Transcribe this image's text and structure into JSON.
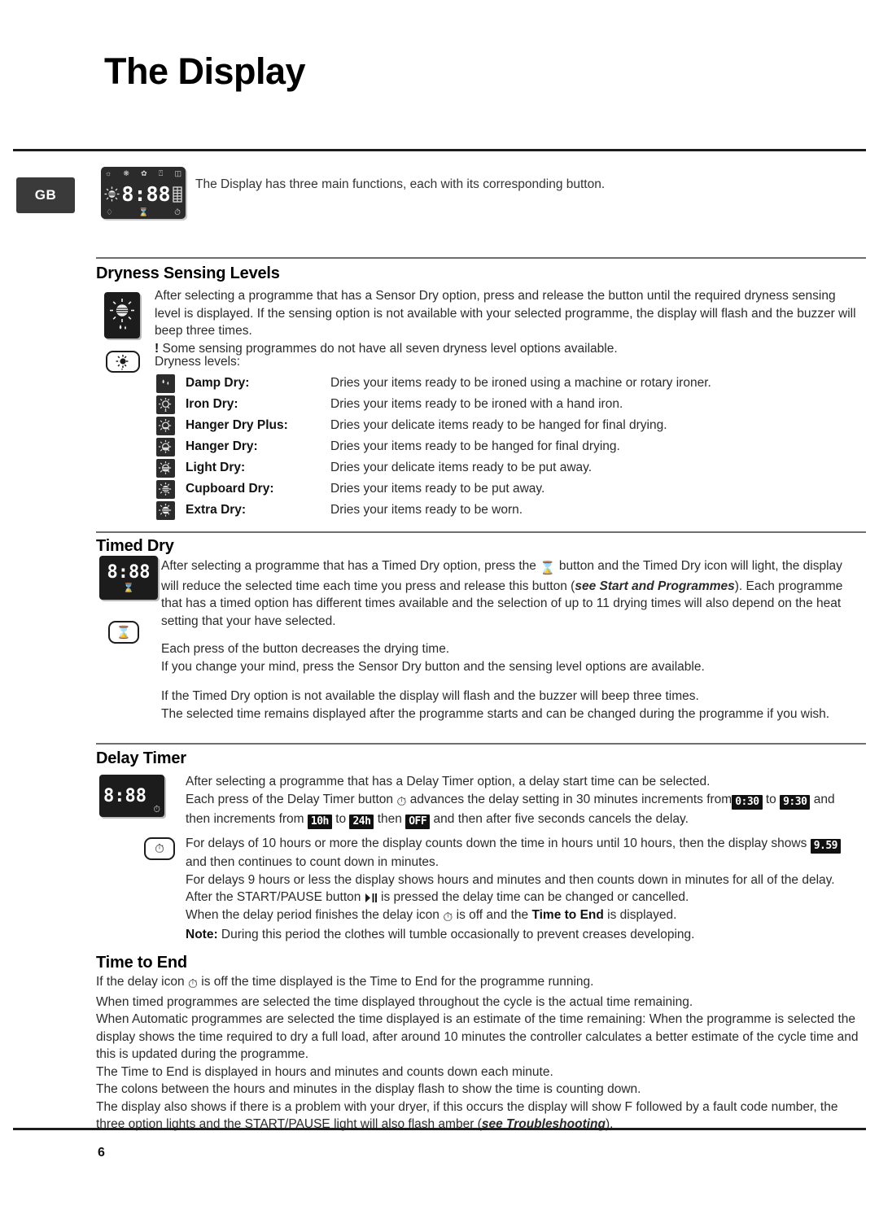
{
  "page": {
    "title": "The Display",
    "number": "6",
    "locale_badge": "GB"
  },
  "intro": {
    "text": "The Display has three main functions, each with its corresponding button.",
    "display_value": "8:88"
  },
  "sections": {
    "dryness": {
      "heading": "Dryness Sensing Levels",
      "paragraph_1": "After selecting a programme that has a Sensor Dry option, press and release the button until the required dryness sensing level is displayed. If the sensing option is not available with your selected programme, the display will flash and the buzzer will beep three times.",
      "warning_mark": "!",
      "warning_text": "Some sensing programmes do not have all seven dryness level options available.",
      "levels_label": "Dryness levels:",
      "levels": [
        {
          "icon": "damp-dry-icon",
          "name": "Damp Dry:",
          "desc": "Dries your items ready to be ironed using a machine or rotary ironer."
        },
        {
          "icon": "iron-dry-icon",
          "name": "Iron Dry:",
          "desc": "Dries your items ready to be ironed with a hand iron."
        },
        {
          "icon": "hanger-dry-plus-icon",
          "name": "Hanger Dry Plus:",
          "desc": "Dries your delicate items ready to be hanged for final drying."
        },
        {
          "icon": "hanger-dry-icon",
          "name": "Hanger Dry:",
          "desc": "Dries your items ready to be hanged for final drying."
        },
        {
          "icon": "light-dry-icon",
          "name": "Light Dry:",
          "desc": "Dries your delicate items ready to be put away."
        },
        {
          "icon": "cupboard-dry-icon",
          "name": "Cupboard Dry:",
          "desc": "Dries your items ready to be put away."
        },
        {
          "icon": "extra-dry-icon",
          "name": "Extra Dry:",
          "desc": "Dries your items ready to be worn."
        }
      ]
    },
    "timed_dry": {
      "heading": "Timed Dry",
      "display_value": "8:88",
      "p1_a": "After selecting a programme that has a Timed Dry option, press the",
      "p1_b": "button and the Timed Dry icon will light, the display will reduce the selected time each time you press and release this button (",
      "p1_ref": "see Start and Programmes",
      "p1_c": "). Each programme that has a timed option has different times available and the selection of up to 11 drying times will also depend on the heat setting that your have selected.",
      "p2": "Each press of the button decreases the drying time.",
      "p3": "If you change your mind, press the Sensor Dry button and the sensing level options are available.",
      "p4": "If the Timed Dry option is not available the display will flash and the buzzer will beep three times.",
      "p5": "The selected time remains displayed after the programme starts and can be changed during the programme if you wish."
    },
    "delay_timer": {
      "heading": "Delay Timer",
      "display_value": "8:88",
      "p1": "After selecting a programme that has a Delay Timer option, a delay start time can be selected.",
      "p2_a": "Each press of the Delay Timer button",
      "p2_b": "advances the delay setting in 30 minutes increments from",
      "badge_from": "0:30",
      "p2_c": "to",
      "badge_to": "9:30",
      "p2_d": "and then increments from",
      "badge_10h": "10h",
      "p2_e": "to",
      "badge_24h": "24h",
      "p2_f": "then",
      "badge_off": "OFF",
      "p2_g": "and then after five seconds cancels the delay.",
      "p3_a": "For delays of 10 hours or more the display counts down the time in hours until 10 hours, then the display shows",
      "badge_959": "9.59",
      "p3_b": "and then continues to count down in minutes.",
      "p4": "For delays 9 hours or less the display shows hours and minutes and then counts down in minutes for all of the delay.",
      "p5_a": "After the START/PAUSE button",
      "p5_b": "is pressed the delay time can be changed or cancelled.",
      "p6_a": "When the delay period finishes the delay icon",
      "p6_b": "is off and the",
      "p6_bold": "Time to End",
      "p6_c": "is displayed.",
      "note_label": "Note:",
      "note_text": "During this period the clothes will tumble occasionally to prevent creases developing."
    },
    "time_to_end": {
      "heading": "Time to End",
      "p1_a": "If the delay icon",
      "p1_b": "is off the time displayed is the Time to End for the programme running.",
      "p2": "When timed programmes are selected the time displayed throughout the cycle is the actual time remaining.",
      "p3": "When Automatic programmes are selected the time displayed is an estimate of the time remaining: When the programme is selected the display shows the time required to dry a full load, after around 10 minutes the controller calculates a better estimate of the cycle time and this is updated during the programme.",
      "p4": "The Time to End is displayed in hours and minutes and counts down each minute.",
      "p5": "The colons between the hours and minutes in the display flash to show the time is counting down.",
      "p6_a": "The display also shows if there is a problem with your dryer, if this occurs the display will show F followed by a fault code number, the three option lights and the START/PAUSE light will also flash amber (",
      "p6_ref": "see Troubleshooting",
      "p6_b": ")."
    }
  }
}
